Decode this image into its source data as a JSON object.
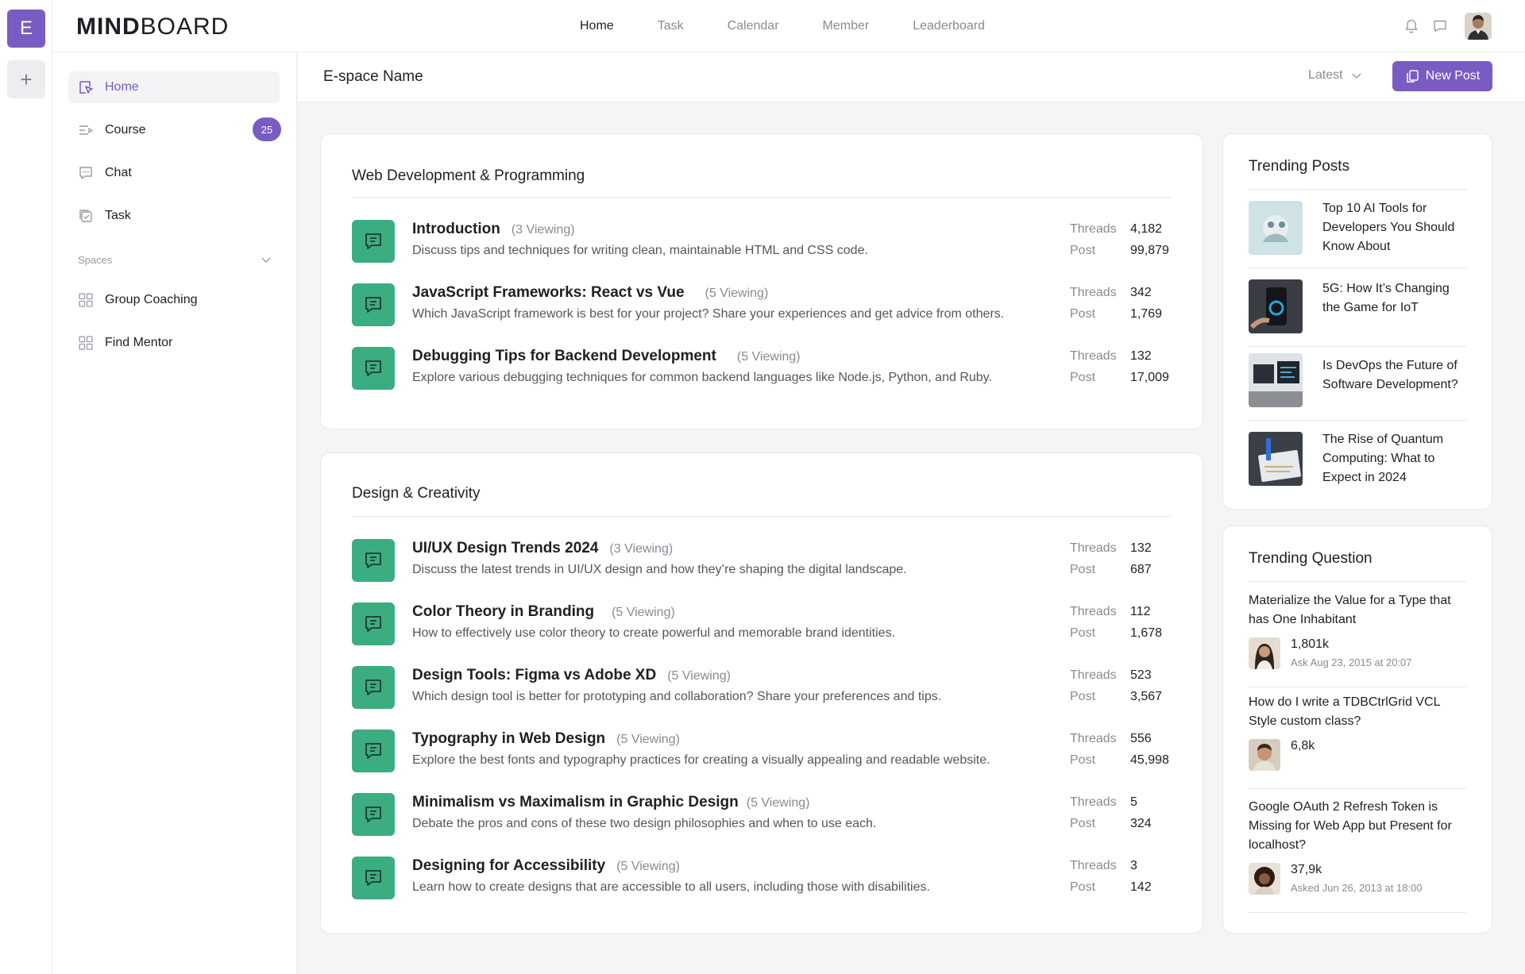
{
  "workspace": {
    "badge_letter": "E",
    "add_symbol": "+"
  },
  "brand": {
    "logo_bold": "MIND",
    "logo_light": "BOARD"
  },
  "nav": [
    {
      "label": "Home",
      "active": true
    },
    {
      "label": "Task",
      "active": false
    },
    {
      "label": "Calendar",
      "active": false
    },
    {
      "label": "Member",
      "active": false
    },
    {
      "label": "Leaderboard",
      "active": false
    }
  ],
  "sidebar": {
    "items": [
      {
        "label": "Home",
        "icon": "home-icon",
        "active": true
      },
      {
        "label": "Course",
        "icon": "course-icon",
        "badge": "25"
      },
      {
        "label": "Chat",
        "icon": "chat-icon"
      },
      {
        "label": "Task",
        "icon": "task-icon"
      }
    ],
    "spaces_label": "Spaces",
    "spaces": [
      {
        "label": "Group Coaching",
        "icon": "grid-icon"
      },
      {
        "label": "Find Mentor",
        "icon": "grid-icon"
      }
    ]
  },
  "subheader": {
    "title": "E-space Name",
    "sort_label": "Latest",
    "new_post_label": "New Post"
  },
  "stat_labels": {
    "threads": "Threads",
    "post": "Post"
  },
  "categories": [
    {
      "title": "Web Development & Programming",
      "topics": [
        {
          "title": "Introduction",
          "viewing": "(3 Viewing)",
          "desc": "Discuss tips and techniques for writing clean, maintainable HTML and CSS code.",
          "threads": "4,182",
          "posts": "99,879"
        },
        {
          "title": "JavaScript Frameworks: React vs Vue",
          "viewing": "(5 Viewing)",
          "desc": "Which JavaScript framework is best for your project? Share your experiences and get advice from others.",
          "threads": "342",
          "posts": "1,769"
        },
        {
          "title": "Debugging Tips for Backend Development",
          "viewing": "(5 Viewing)",
          "desc": "Explore various debugging techniques for common backend languages like Node.js, Python, and Ruby.",
          "threads": "132",
          "posts": "17,009"
        }
      ]
    },
    {
      "title": "Design & Creativity",
      "topics": [
        {
          "title": "UI/UX Design Trends 2024",
          "viewing": "(3 Viewing)",
          "desc": "Discuss the latest trends in UI/UX design and how they’re shaping the digital landscape.",
          "threads": "132",
          "posts": "687"
        },
        {
          "title": "Color Theory in Branding",
          "viewing": "(5 Viewing)",
          "desc": "How to effectively use color theory to create powerful and memorable brand identities.",
          "threads": "112",
          "posts": "1,678"
        },
        {
          "title": "Design Tools: Figma vs Adobe XD",
          "viewing": "(5 Viewing)",
          "desc": "Which design tool is better for prototyping and collaboration? Share your preferences and tips.",
          "threads": "523",
          "posts": "3,567"
        },
        {
          "title": "Typography in Web Design",
          "viewing": "(5 Viewing)",
          "desc": "Explore the best fonts and typography practices for creating a visually appealing and readable website.",
          "threads": "556",
          "posts": "45,998"
        },
        {
          "title": "Minimalism vs Maximalism in Graphic Design",
          "viewing": "(5 Viewing)",
          "desc": "Debate the pros and cons of these two design philosophies and when to use each.",
          "threads": "5",
          "posts": "324"
        },
        {
          "title": "Designing for Accessibility",
          "viewing": "(5 Viewing)",
          "desc": "Learn how to create designs that are accessible to all users, including those with disabilities.",
          "threads": "3",
          "posts": "142"
        }
      ]
    }
  ],
  "trending_posts": {
    "title": "Trending Posts",
    "items": [
      {
        "text": "Top 10 AI Tools for Developers You Should Know About"
      },
      {
        "text": "5G: How It’s Changing the Game for IoT"
      },
      {
        "text": "Is DevOps the Future of Software Development?"
      },
      {
        "text": "The Rise of Quantum Computing: What to Expect in 2024"
      }
    ]
  },
  "trending_questions": {
    "title": "Trending Question",
    "items": [
      {
        "text": "Materialize the Value for a Type that has One Inhabitant",
        "count": "1,801k",
        "date": "Ask Aug 23, 2015 at 20:07"
      },
      {
        "text": "How do I write a TDBCtrlGrid VCL Style custom class?",
        "count": "6,8k",
        "date": ""
      },
      {
        "text": "Google OAuth 2 Refresh Token is Missing for Web App but Present for localhost?",
        "count": "37,9k",
        "date": "Asked Jun 26, 2013 at 18:00"
      }
    ]
  },
  "colors": {
    "accent": "#7a5bc1",
    "topic_icon": "#3cad80",
    "muted": "#8a8a93"
  }
}
